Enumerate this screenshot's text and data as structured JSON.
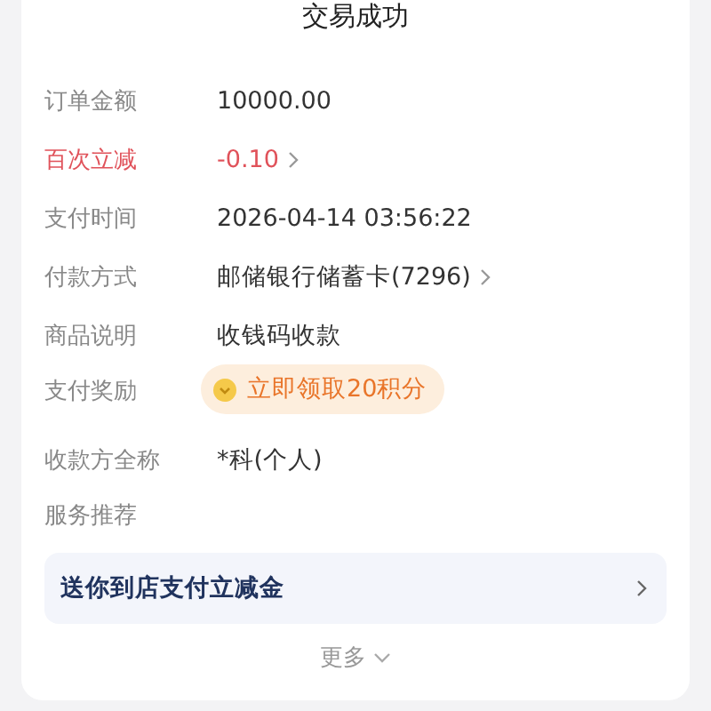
{
  "title": "交易成功",
  "rows": [
    {
      "label": "订单金额",
      "value": "10000.00",
      "kind": "text",
      "highlighted": false
    },
    {
      "label": "百次立减",
      "value": "-0.10",
      "kind": "link",
      "highlighted": true
    },
    {
      "label": "支付时间",
      "value": "2026-04-14 03:56:22",
      "kind": "text",
      "highlighted": false
    },
    {
      "label": "付款方式",
      "value": "邮储银行储蓄卡(7296)",
      "kind": "link",
      "highlighted": false
    },
    {
      "label": "商品说明",
      "value": "收钱码收款",
      "kind": "text",
      "highlighted": false
    },
    {
      "label": "支付奖励",
      "value": "立即领取20积分",
      "kind": "reward",
      "highlighted": false
    },
    {
      "label": "收款方全称",
      "value": "*科(个人)",
      "kind": "text",
      "highlighted": false
    }
  ],
  "services": {
    "heading": "服务推荐",
    "banner": "送你到店支付立减金"
  },
  "more": "更多"
}
